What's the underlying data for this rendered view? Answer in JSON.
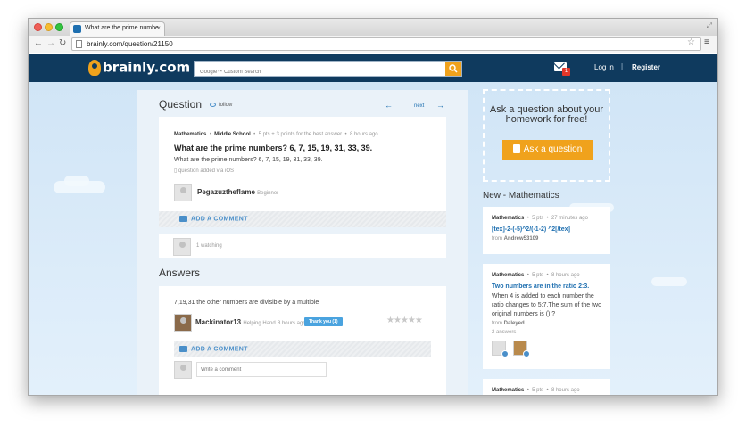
{
  "browser": {
    "tab_title": "What are the prime numbe",
    "tab_close": "×",
    "url": "brainly.com/question/21150"
  },
  "header": {
    "logo": "brainly.com",
    "search_placeholder": "Google™ Custom Search",
    "mail_count": "1",
    "login": "Log in",
    "divider": "|",
    "register": "Register"
  },
  "question": {
    "section_title": "Question",
    "follow": "follow",
    "next": "next",
    "subject": "Mathematics",
    "level": "Middle School",
    "points": "5 pts + 3 points for the best answer",
    "time": "8 hours ago",
    "title": "What are the prime numbers? 6, 7, 15, 19, 31, 33, 39.",
    "body": "What are the prime numbers? 6, 7, 15, 19, 31, 33, 39.",
    "added_via": "question added via iOS",
    "username": "Pegazuztheflame",
    "rank": "Beginner",
    "add_comment": "ADD A COMMENT",
    "watching": "1 watching"
  },
  "answers": {
    "section_title": "Answers",
    "items": [
      {
        "text": "7,19,31 the other numbers are divisible by a multiple",
        "username": "Mackinator13",
        "rank": "Helping Hand",
        "time": "8 hours ago",
        "thank_label": "Thank you (1)",
        "stars": "★★★★★",
        "stars_filled": 0,
        "add_comment": "ADD A COMMENT",
        "comment_placeholder": "Write a comment"
      }
    ]
  },
  "sidebar": {
    "ask_text": "Ask a question about your homework for free!",
    "ask_button": "Ask a question",
    "new_title": "New - Mathematics",
    "items": [
      {
        "subject": "Mathematics",
        "points": "5 pts",
        "time": "27 minutes ago",
        "title": "[tex]-2-(-5)^2/(-1-2) ^2[/tex]",
        "body": "",
        "from_prefix": "from",
        "from": "Andrew53109"
      },
      {
        "subject": "Mathematics",
        "points": "5 pts",
        "time": "8 hours ago",
        "title": "Two numbers are in the ratio 2:3.",
        "body": "When 4 is added to each number the ratio changes to 5:7.The sum of the two original numbers is () ?",
        "from_prefix": "from",
        "from": "Daleyed",
        "answers": "2 answers"
      },
      {
        "subject": "Mathematics",
        "points": "5 pts",
        "time": "8 hours ago"
      }
    ]
  },
  "colors": {
    "header_bg": "#0f3a5e",
    "accent_orange": "#f0a21c",
    "link_blue": "#1e6fb0",
    "page_bg": "#d6e8f7"
  }
}
